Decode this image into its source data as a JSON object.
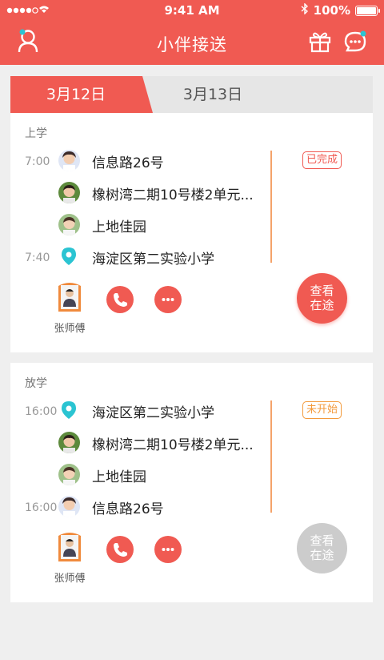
{
  "status_bar": {
    "time": "9:41 AM",
    "battery": "100%"
  },
  "header": {
    "title": "小伴接送"
  },
  "date_tabs": [
    {
      "label": "3月12日",
      "active": true
    },
    {
      "label": "3月13日",
      "active": false
    }
  ],
  "trips": [
    {
      "section": "上学",
      "status": "已完成",
      "stops": [
        {
          "time": "7:00",
          "label": "信息路26号",
          "marker": "avatar"
        },
        {
          "time": "",
          "label": "橡树湾二期10号楼2单元...",
          "marker": "avatar"
        },
        {
          "time": "",
          "label": "上地佳园",
          "marker": "avatar"
        },
        {
          "time": "7:40",
          "label": "海淀区第二实验小学",
          "marker": "location-pin"
        }
      ],
      "driver": "张师傅",
      "track_button": {
        "line1": "查看",
        "line2": "在途",
        "enabled": true
      }
    },
    {
      "section": "放学",
      "status": "未开始",
      "stops": [
        {
          "time": "16:00",
          "label": "海淀区第二实验小学",
          "marker": "location-pin"
        },
        {
          "time": "",
          "label": "橡树湾二期10号楼2单元...",
          "marker": "avatar"
        },
        {
          "time": "",
          "label": "上地佳园",
          "marker": "avatar"
        },
        {
          "time": "16:00",
          "label": "信息路26号",
          "marker": "avatar"
        }
      ],
      "driver": "张师傅",
      "track_button": {
        "line1": "查看",
        "line2": "在途",
        "enabled": false
      }
    }
  ],
  "colors": {
    "brand": "#f05a52",
    "pin": "#2bc4d2",
    "pending": "#f39a3c",
    "disabled": "#cccccc"
  }
}
